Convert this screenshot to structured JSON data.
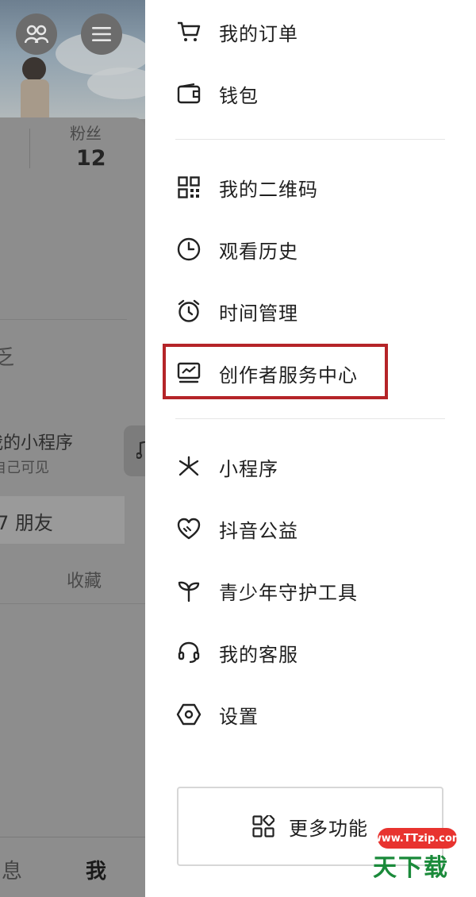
{
  "profile": {
    "stat_label": "粉丝",
    "stat_value": "12",
    "frag_text_1": "乏",
    "frag_title": "我的小程序",
    "frag_sub": "自己可见",
    "frag_friends": "7 朋友",
    "frag_collect": "收藏"
  },
  "bottom_nav": {
    "messages": "息",
    "me": "我"
  },
  "drawer": {
    "items_top": [
      {
        "label": "我的订单",
        "icon": "cart-icon"
      },
      {
        "label": "钱包",
        "icon": "wallet-icon"
      }
    ],
    "items_mid": [
      {
        "label": "我的二维码",
        "icon": "qr-code-icon"
      },
      {
        "label": "观看历史",
        "icon": "clock-icon"
      },
      {
        "label": "时间管理",
        "icon": "alarm-icon"
      },
      {
        "label": "创作者服务中心",
        "icon": "creator-monitor-icon"
      }
    ],
    "items_bottom": [
      {
        "label": "小程序",
        "icon": "mini-program-icon"
      },
      {
        "label": "抖音公益",
        "icon": "charity-heart-icon"
      },
      {
        "label": "青少年守护工具",
        "icon": "sprout-icon"
      },
      {
        "label": "我的客服",
        "icon": "headset-icon"
      },
      {
        "label": "设置",
        "icon": "settings-hexagon-icon"
      }
    ],
    "more_label": "更多功能"
  },
  "watermark": {
    "url": "www.TTzip.com",
    "text": "天下载"
  },
  "colors": {
    "highlight_border": "#b52428",
    "overlay": "#8a8a8a"
  }
}
